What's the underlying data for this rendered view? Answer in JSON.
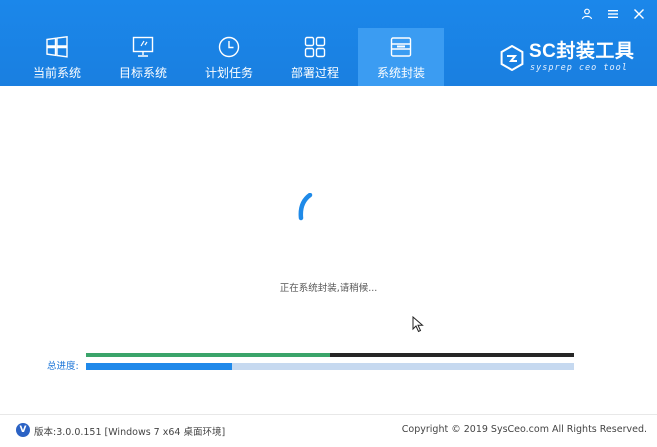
{
  "window": {
    "controls": [
      {
        "name": "user-icon",
        "label": "user"
      },
      {
        "name": "menu-icon",
        "label": "menu"
      },
      {
        "name": "close-icon",
        "label": "close"
      }
    ]
  },
  "tabs": [
    {
      "label": "当前系统",
      "icon": "windows-logo-icon"
    },
    {
      "label": "目标系统",
      "icon": "monitor-icon"
    },
    {
      "label": "计划任务",
      "icon": "clock-icon"
    },
    {
      "label": "部署过程",
      "icon": "grid-icon"
    },
    {
      "label": "系统封装",
      "icon": "box-icon",
      "active": true
    }
  ],
  "brand": {
    "title": "SC封装工具",
    "subtitle": "sysprep ceo tool"
  },
  "main": {
    "status": "正在系统封装,请稍候..."
  },
  "progress": {
    "current_fraction": 0.5,
    "total_label": "总进度:",
    "total_fraction": 0.3
  },
  "footer": {
    "version": "版本:3.0.0.151 [Windows 7 x64 桌面环境]",
    "copyright": "Copyright © 2019 SysCeo.com All Rights Reserved."
  },
  "colors": {
    "header": "#1a7fe0",
    "active_tab": "#3b9cf2",
    "sub_progress_fill": "#3aa46a",
    "sub_progress_track": "#262626",
    "total_progress_fill": "#2089ea",
    "total_progress_track": "#c6d9f0"
  }
}
